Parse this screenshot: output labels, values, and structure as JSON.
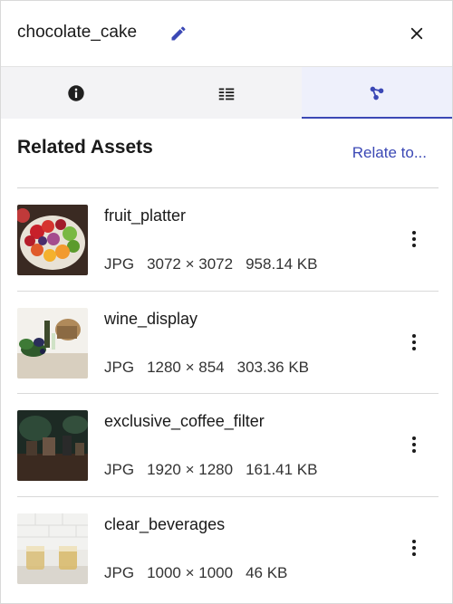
{
  "header": {
    "title": "chocolate_cake",
    "edit_icon": "pencil-icon",
    "close_icon": "close-icon"
  },
  "tabs": [
    {
      "icon": "info-icon",
      "active": false
    },
    {
      "icon": "list-detail-icon",
      "active": false
    },
    {
      "icon": "relations-graph-icon",
      "active": true
    }
  ],
  "section": {
    "title": "Related Assets",
    "relate_label": "Relate to..."
  },
  "assets": [
    {
      "name": "fruit_platter",
      "format": "JPG",
      "dimensions": "3072 × 3072",
      "size": "958.14 KB"
    },
    {
      "name": "wine_display",
      "format": "JPG",
      "dimensions": "1280 × 854",
      "size": "303.36 KB"
    },
    {
      "name": "exclusive_coffee_filter",
      "format": "JPG",
      "dimensions": "1920 × 1280",
      "size": "161.41 KB"
    },
    {
      "name": "clear_beverages",
      "format": "JPG",
      "dimensions": "1000 × 1000",
      "size": "46 KB"
    }
  ],
  "colors": {
    "accent": "#3b48b5",
    "active_tab_bg": "#eef0fb"
  }
}
